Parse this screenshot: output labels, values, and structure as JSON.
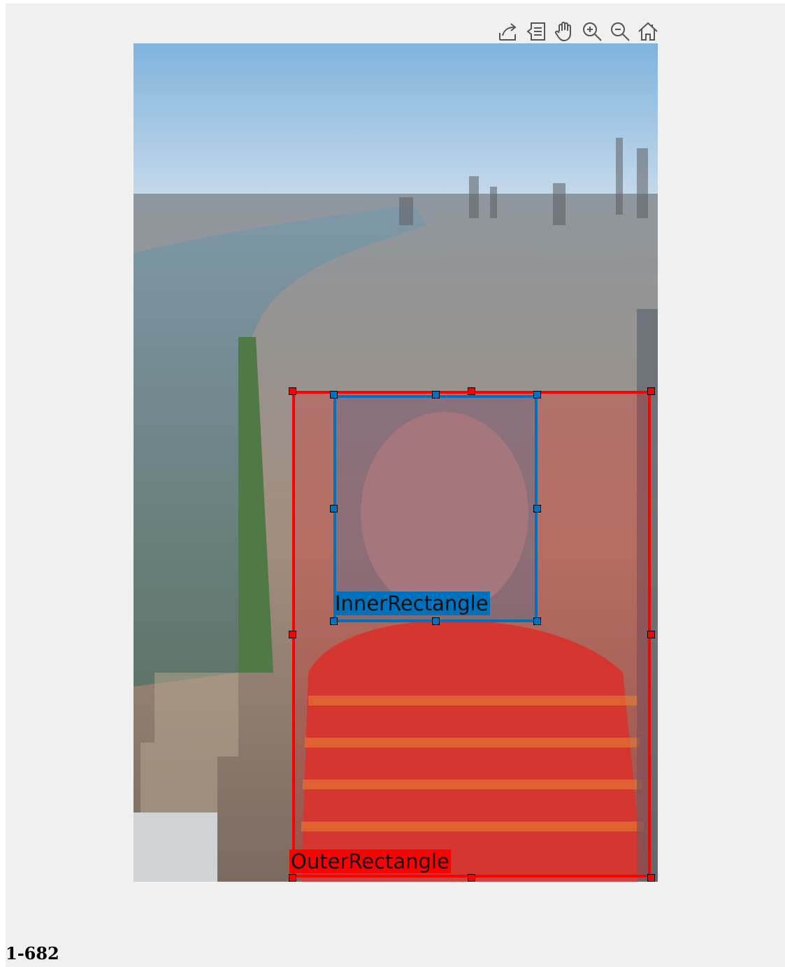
{
  "toolbar": {
    "icons": [
      "export-icon",
      "data-tips-icon",
      "pan-hand-icon",
      "zoom-in-icon",
      "zoom-out-icon",
      "home-icon"
    ]
  },
  "rois": {
    "outer": {
      "label": "OuterRectangle",
      "color": "#ff0000"
    },
    "inner": {
      "label": "InnerRectangle",
      "color": "#0072bd"
    }
  },
  "footer": {
    "label": "1-682"
  }
}
